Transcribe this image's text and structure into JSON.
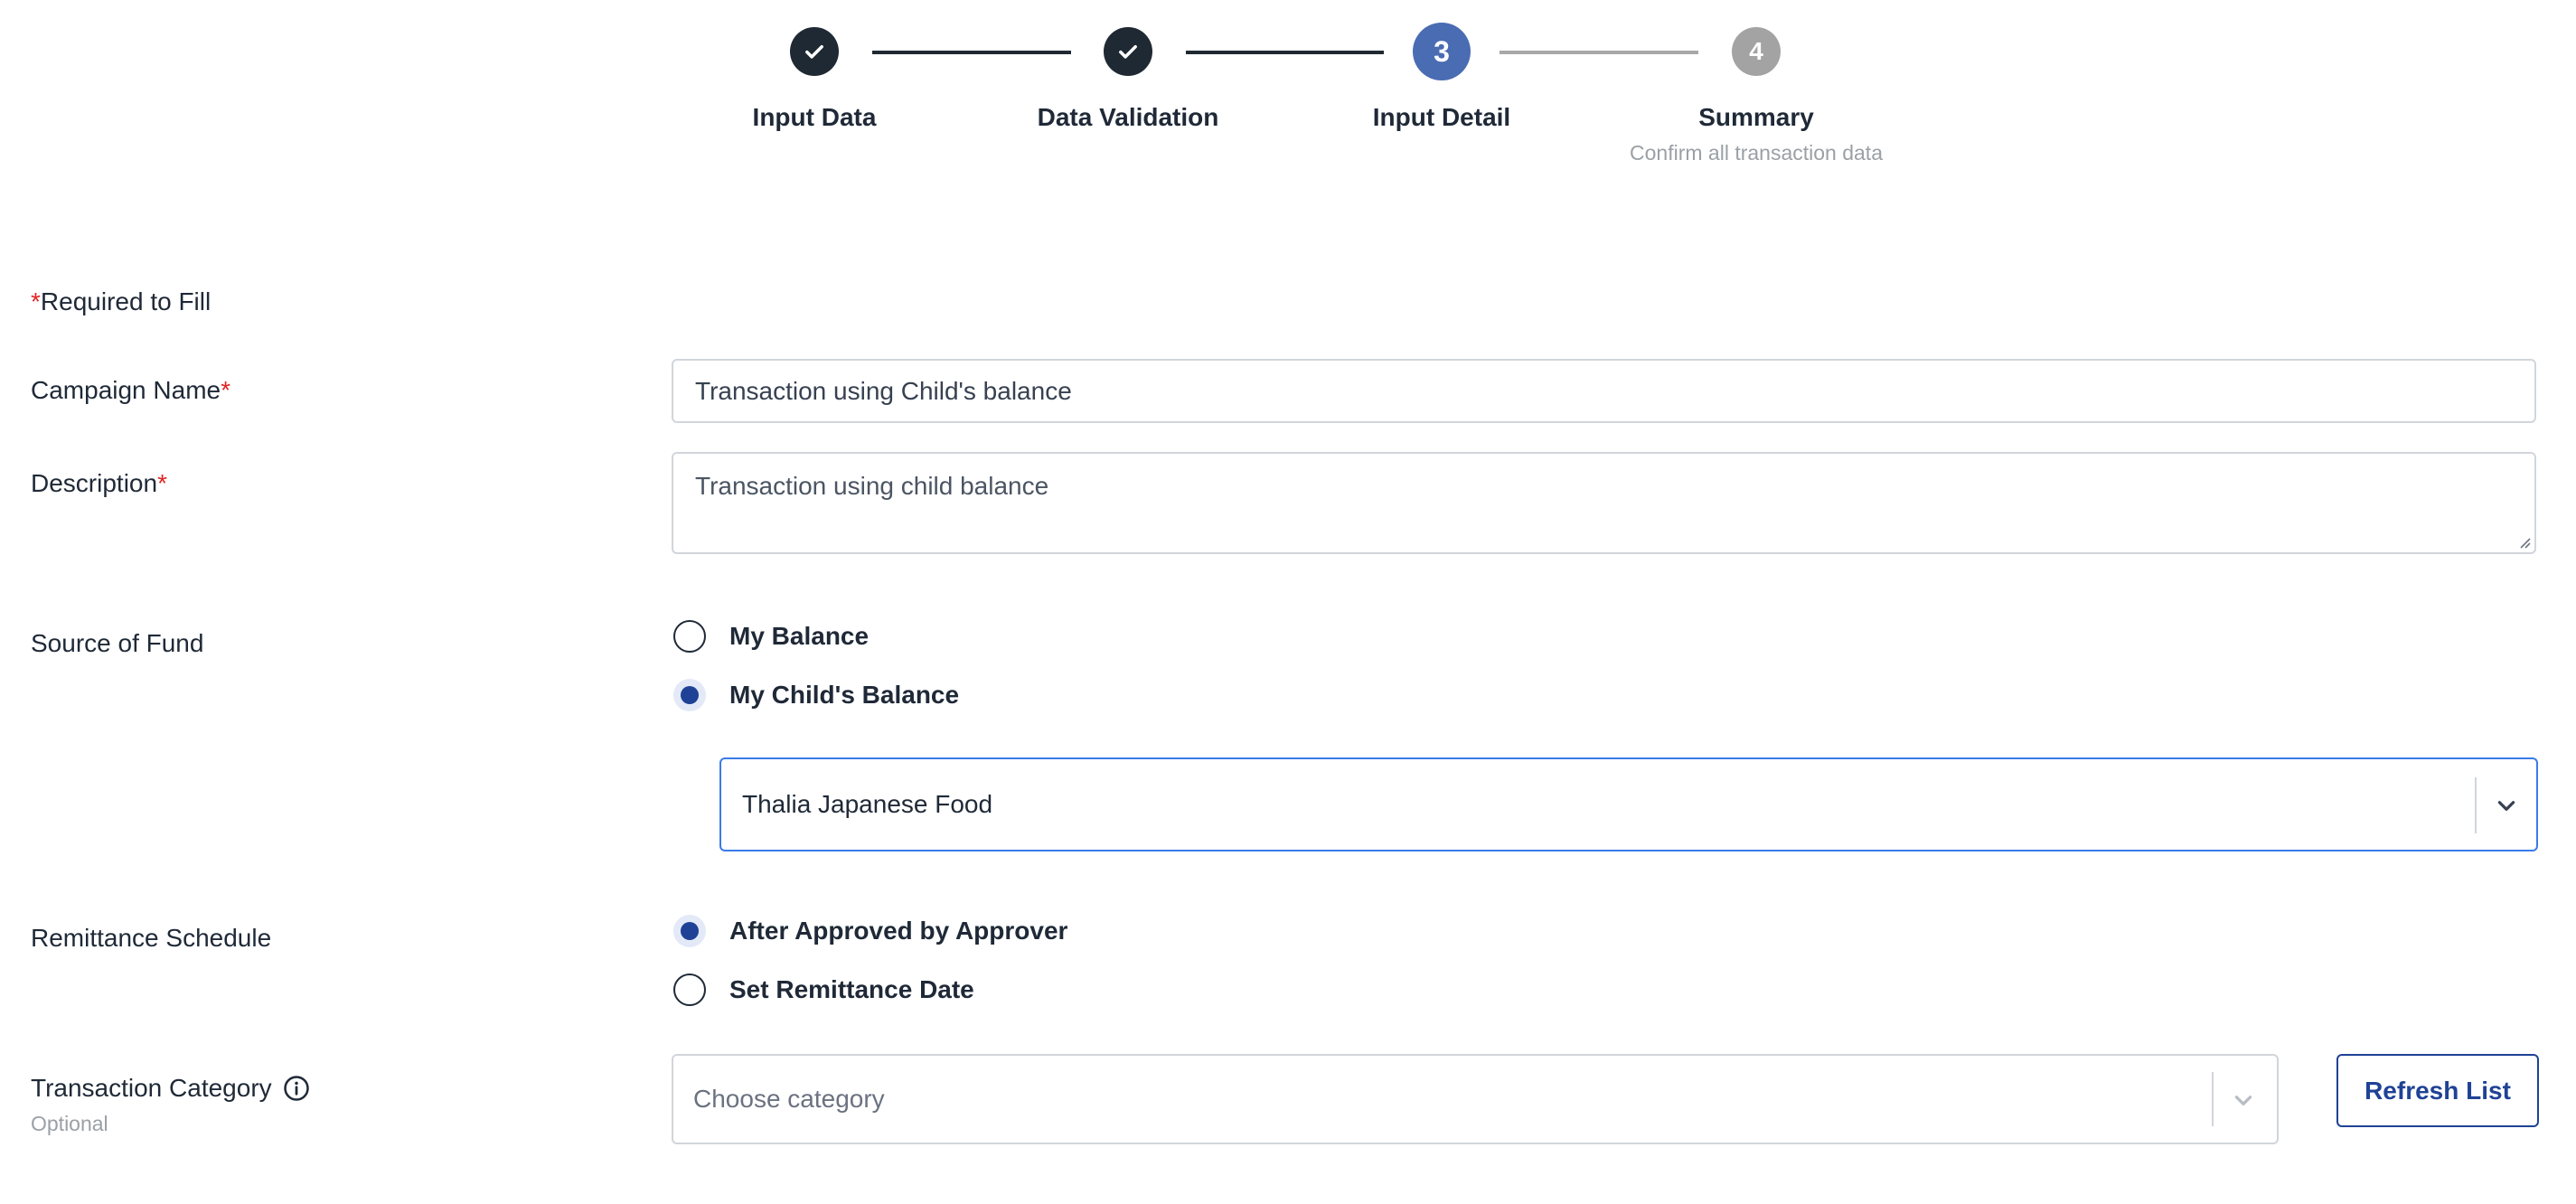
{
  "stepper": {
    "steps": [
      {
        "number": "1",
        "label": "Input Data",
        "status": "done",
        "sub": ""
      },
      {
        "number": "2",
        "label": "Data Validation",
        "status": "done",
        "sub": ""
      },
      {
        "number": "3",
        "label": "Input Detail",
        "status": "active",
        "sub": ""
      },
      {
        "number": "4",
        "label": "Summary",
        "status": "pending",
        "sub": "Confirm all transaction data"
      }
    ]
  },
  "form": {
    "required_note_mark": "*",
    "required_note_text": "Required to Fill",
    "required_mark": "*",
    "campaign_name": {
      "label": "Campaign Name",
      "value": "Transaction using Child's balance"
    },
    "description": {
      "label": "Description",
      "value": "Transaction using child balance"
    },
    "source_of_fund": {
      "label": "Source of Fund",
      "options": [
        "My Balance",
        "My Child's Balance"
      ],
      "selected": "My Child's Balance",
      "child_account": "Thalia Japanese Food"
    },
    "remittance_schedule": {
      "label": "Remittance Schedule",
      "options": [
        "After Approved by Approver",
        "Set Remittance Date"
      ],
      "selected": "After Approved by Approver"
    },
    "transaction_category": {
      "label": "Transaction Category",
      "sublabel": "Optional",
      "placeholder": "Choose category",
      "refresh_label": "Refresh List"
    }
  },
  "colors": {
    "accent": "#1f4296",
    "active_step": "#4a6cb3",
    "done_step": "#1f2933",
    "pending_step": "#a3a3a3",
    "required": "#e02424",
    "focus_border": "#3b7be8"
  },
  "icons": {
    "check": "check-icon",
    "info": "info-icon",
    "chevron": "chevron-down-icon"
  }
}
